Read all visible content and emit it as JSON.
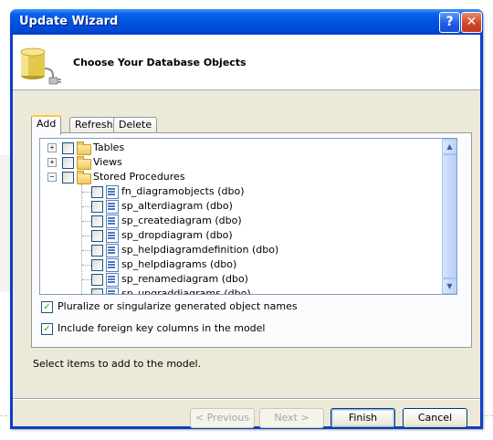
{
  "window": {
    "title": "Update Wizard"
  },
  "header": {
    "title": "Choose Your Database Objects"
  },
  "tabs": [
    {
      "label": "Add",
      "active": true
    },
    {
      "label": "Refresh",
      "active": false
    },
    {
      "label": "Delete",
      "active": false
    }
  ],
  "tree": {
    "groups": [
      {
        "label": "Tables",
        "expanded": false,
        "checked": false
      },
      {
        "label": "Views",
        "expanded": false,
        "checked": false
      },
      {
        "label": "Stored Procedures",
        "expanded": true,
        "checked": false
      }
    ],
    "procedures": [
      {
        "label": "fn_diagramobjects (dbo)",
        "checked": false
      },
      {
        "label": "sp_alterdiagram (dbo)",
        "checked": false
      },
      {
        "label": "sp_creatediagram (dbo)",
        "checked": false
      },
      {
        "label": "sp_dropdiagram (dbo)",
        "checked": false
      },
      {
        "label": "sp_helpdiagramdefinition (dbo)",
        "checked": false
      },
      {
        "label": "sp_helpdiagrams (dbo)",
        "checked": false
      },
      {
        "label": "sp_renamediagram (dbo)",
        "checked": false
      },
      {
        "label": "sp_upgraddiagrams (dbo)",
        "checked": false
      }
    ]
  },
  "options": {
    "pluralize": {
      "label": "Pluralize or singularize generated object names",
      "checked": true
    },
    "foreign_keys": {
      "label": "Include foreign key columns in the model",
      "checked": true
    }
  },
  "status": "Select items to add to the model.",
  "buttons": {
    "previous": "< Previous",
    "next": "Next >",
    "finish": "Finish",
    "cancel": "Cancel"
  },
  "colors": {
    "titlebar": "#0054e3",
    "dialog_bg": "#ece9d8",
    "tab_highlight": "#ffc83c",
    "check": "#21a121"
  }
}
